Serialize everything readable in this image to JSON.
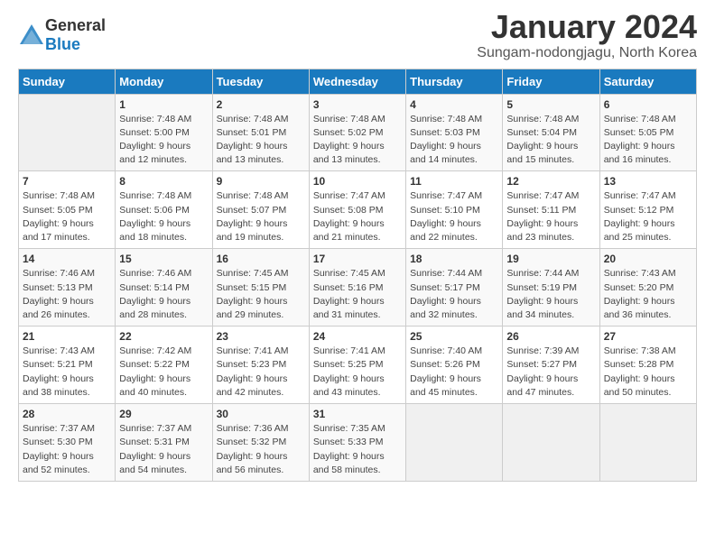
{
  "logo": {
    "general": "General",
    "blue": "Blue"
  },
  "title": "January 2024",
  "subtitle": "Sungam-nodongjagu, North Korea",
  "days_of_week": [
    "Sunday",
    "Monday",
    "Tuesday",
    "Wednesday",
    "Thursday",
    "Friday",
    "Saturday"
  ],
  "weeks": [
    [
      {
        "day": "",
        "sunrise": "",
        "sunset": "",
        "daylight": ""
      },
      {
        "day": "1",
        "sunrise": "Sunrise: 7:48 AM",
        "sunset": "Sunset: 5:00 PM",
        "daylight": "Daylight: 9 hours and 12 minutes."
      },
      {
        "day": "2",
        "sunrise": "Sunrise: 7:48 AM",
        "sunset": "Sunset: 5:01 PM",
        "daylight": "Daylight: 9 hours and 13 minutes."
      },
      {
        "day": "3",
        "sunrise": "Sunrise: 7:48 AM",
        "sunset": "Sunset: 5:02 PM",
        "daylight": "Daylight: 9 hours and 13 minutes."
      },
      {
        "day": "4",
        "sunrise": "Sunrise: 7:48 AM",
        "sunset": "Sunset: 5:03 PM",
        "daylight": "Daylight: 9 hours and 14 minutes."
      },
      {
        "day": "5",
        "sunrise": "Sunrise: 7:48 AM",
        "sunset": "Sunset: 5:04 PM",
        "daylight": "Daylight: 9 hours and 15 minutes."
      },
      {
        "day": "6",
        "sunrise": "Sunrise: 7:48 AM",
        "sunset": "Sunset: 5:05 PM",
        "daylight": "Daylight: 9 hours and 16 minutes."
      }
    ],
    [
      {
        "day": "7",
        "sunrise": "Sunrise: 7:48 AM",
        "sunset": "Sunset: 5:05 PM",
        "daylight": "Daylight: 9 hours and 17 minutes."
      },
      {
        "day": "8",
        "sunrise": "Sunrise: 7:48 AM",
        "sunset": "Sunset: 5:06 PM",
        "daylight": "Daylight: 9 hours and 18 minutes."
      },
      {
        "day": "9",
        "sunrise": "Sunrise: 7:48 AM",
        "sunset": "Sunset: 5:07 PM",
        "daylight": "Daylight: 9 hours and 19 minutes."
      },
      {
        "day": "10",
        "sunrise": "Sunrise: 7:47 AM",
        "sunset": "Sunset: 5:08 PM",
        "daylight": "Daylight: 9 hours and 21 minutes."
      },
      {
        "day": "11",
        "sunrise": "Sunrise: 7:47 AM",
        "sunset": "Sunset: 5:10 PM",
        "daylight": "Daylight: 9 hours and 22 minutes."
      },
      {
        "day": "12",
        "sunrise": "Sunrise: 7:47 AM",
        "sunset": "Sunset: 5:11 PM",
        "daylight": "Daylight: 9 hours and 23 minutes."
      },
      {
        "day": "13",
        "sunrise": "Sunrise: 7:47 AM",
        "sunset": "Sunset: 5:12 PM",
        "daylight": "Daylight: 9 hours and 25 minutes."
      }
    ],
    [
      {
        "day": "14",
        "sunrise": "Sunrise: 7:46 AM",
        "sunset": "Sunset: 5:13 PM",
        "daylight": "Daylight: 9 hours and 26 minutes."
      },
      {
        "day": "15",
        "sunrise": "Sunrise: 7:46 AM",
        "sunset": "Sunset: 5:14 PM",
        "daylight": "Daylight: 9 hours and 28 minutes."
      },
      {
        "day": "16",
        "sunrise": "Sunrise: 7:45 AM",
        "sunset": "Sunset: 5:15 PM",
        "daylight": "Daylight: 9 hours and 29 minutes."
      },
      {
        "day": "17",
        "sunrise": "Sunrise: 7:45 AM",
        "sunset": "Sunset: 5:16 PM",
        "daylight": "Daylight: 9 hours and 31 minutes."
      },
      {
        "day": "18",
        "sunrise": "Sunrise: 7:44 AM",
        "sunset": "Sunset: 5:17 PM",
        "daylight": "Daylight: 9 hours and 32 minutes."
      },
      {
        "day": "19",
        "sunrise": "Sunrise: 7:44 AM",
        "sunset": "Sunset: 5:19 PM",
        "daylight": "Daylight: 9 hours and 34 minutes."
      },
      {
        "day": "20",
        "sunrise": "Sunrise: 7:43 AM",
        "sunset": "Sunset: 5:20 PM",
        "daylight": "Daylight: 9 hours and 36 minutes."
      }
    ],
    [
      {
        "day": "21",
        "sunrise": "Sunrise: 7:43 AM",
        "sunset": "Sunset: 5:21 PM",
        "daylight": "Daylight: 9 hours and 38 minutes."
      },
      {
        "day": "22",
        "sunrise": "Sunrise: 7:42 AM",
        "sunset": "Sunset: 5:22 PM",
        "daylight": "Daylight: 9 hours and 40 minutes."
      },
      {
        "day": "23",
        "sunrise": "Sunrise: 7:41 AM",
        "sunset": "Sunset: 5:23 PM",
        "daylight": "Daylight: 9 hours and 42 minutes."
      },
      {
        "day": "24",
        "sunrise": "Sunrise: 7:41 AM",
        "sunset": "Sunset: 5:25 PM",
        "daylight": "Daylight: 9 hours and 43 minutes."
      },
      {
        "day": "25",
        "sunrise": "Sunrise: 7:40 AM",
        "sunset": "Sunset: 5:26 PM",
        "daylight": "Daylight: 9 hours and 45 minutes."
      },
      {
        "day": "26",
        "sunrise": "Sunrise: 7:39 AM",
        "sunset": "Sunset: 5:27 PM",
        "daylight": "Daylight: 9 hours and 47 minutes."
      },
      {
        "day": "27",
        "sunrise": "Sunrise: 7:38 AM",
        "sunset": "Sunset: 5:28 PM",
        "daylight": "Daylight: 9 hours and 50 minutes."
      }
    ],
    [
      {
        "day": "28",
        "sunrise": "Sunrise: 7:37 AM",
        "sunset": "Sunset: 5:30 PM",
        "daylight": "Daylight: 9 hours and 52 minutes."
      },
      {
        "day": "29",
        "sunrise": "Sunrise: 7:37 AM",
        "sunset": "Sunset: 5:31 PM",
        "daylight": "Daylight: 9 hours and 54 minutes."
      },
      {
        "day": "30",
        "sunrise": "Sunrise: 7:36 AM",
        "sunset": "Sunset: 5:32 PM",
        "daylight": "Daylight: 9 hours and 56 minutes."
      },
      {
        "day": "31",
        "sunrise": "Sunrise: 7:35 AM",
        "sunset": "Sunset: 5:33 PM",
        "daylight": "Daylight: 9 hours and 58 minutes."
      },
      {
        "day": "",
        "sunrise": "",
        "sunset": "",
        "daylight": ""
      },
      {
        "day": "",
        "sunrise": "",
        "sunset": "",
        "daylight": ""
      },
      {
        "day": "",
        "sunrise": "",
        "sunset": "",
        "daylight": ""
      }
    ]
  ]
}
